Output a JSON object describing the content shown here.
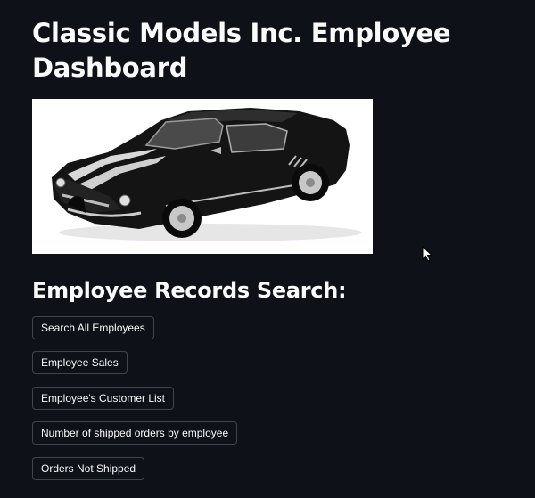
{
  "page": {
    "title": "Classic Models Inc. Employee Dashboard"
  },
  "hero_image": {
    "icon": "black-muscle-car-image"
  },
  "search_section": {
    "heading": "Employee Records Search:",
    "buttons": [
      {
        "label": "Search All Employees"
      },
      {
        "label": "Employee Sales"
      },
      {
        "label": "Employee's Customer List"
      },
      {
        "label": "Number of shipped orders by employee"
      },
      {
        "label": "Orders Not Shipped"
      }
    ]
  },
  "cursor": {
    "icon": "mouse-pointer-icon"
  },
  "colors": {
    "background": "#0e1117",
    "text": "#fafafa",
    "button_border": "rgba(250,250,250,0.22)"
  }
}
